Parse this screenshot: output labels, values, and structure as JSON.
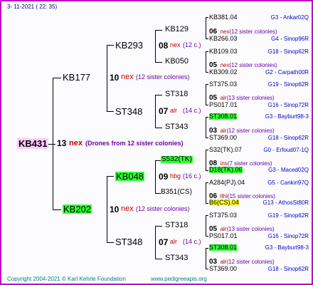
{
  "header": {
    "date": "3- 11-2021 ( 22: 35)"
  },
  "root": {
    "label": "KB431",
    "count": "13",
    "code": "nex",
    "note": "(Drones from 12 sister colonies)"
  },
  "gen1": [
    {
      "label": "KB177",
      "count": "10",
      "code": "nex",
      "note": "(12 sister colonies)"
    },
    {
      "label": "KB202",
      "count": "10",
      "code": "nex",
      "note": "(12 sister colonies)"
    }
  ],
  "gen2": [
    {
      "label": "KB293",
      "count": "08",
      "code": "nex",
      "note": "(12 c.)"
    },
    {
      "label": "ST348",
      "count": "07",
      "code": "alr",
      "note": "(14 c.)"
    },
    {
      "label": "KB048",
      "count": "09",
      "code": "hbg",
      "note": "(16 c.)"
    },
    {
      "label": "ST348",
      "count": "07",
      "code": "alr",
      "note": "(14 c.)"
    }
  ],
  "gen3": [
    {
      "label": "KB129",
      "count": "06",
      "code": "nex",
      "note": "(12 sister colonies)"
    },
    {
      "label": "KB050",
      "count": "05",
      "code": "nex",
      "note": "(12 sister colonies)"
    },
    {
      "label": "ST318",
      "count": "05",
      "code": "alr",
      "note": "(13 sister colonies)"
    },
    {
      "label": "ST343",
      "count": "03",
      "code": "alr",
      "note": "(12 sister colonies)"
    },
    {
      "label": "S532(TK)",
      "count": "08",
      "code": "ins",
      "note": "(7 sister colonies)"
    },
    {
      "label": "B351(CS)",
      "count": "06",
      "code": "lthl",
      "note": "(15 sister colonies)"
    },
    {
      "label": "ST318",
      "count": "05",
      "code": "alr",
      "note": "(13 sister colonies)"
    },
    {
      "label": "ST343",
      "count": "03",
      "code": "alr",
      "note": "(12 sister colonies)"
    }
  ],
  "gen4": [
    {
      "label": "KB381.04",
      "place": "G3 - Ankar02Q"
    },
    {
      "label": "KB266.03",
      "place": "G4 - Sinop96R"
    },
    {
      "label": "KB109.03",
      "place": "G18 - Sinop62R"
    },
    {
      "label": "KB309.02",
      "place": "G2 - Carpath00R"
    },
    {
      "label": "ST375.03",
      "place": "G19 - Sinop62R"
    },
    {
      "label": "PS017.01",
      "place": "G16 - Sinop72R"
    },
    {
      "label": "ST308.01",
      "place": "G3 - Bayburt98-3"
    },
    {
      "label": "ST369.00",
      "place": "G18 - Sinop62R"
    },
    {
      "label": "S32(TK).07",
      "place": "G0 - Erfoud07-1Q"
    },
    {
      "label": "D18(TK).06",
      "place": "G3 - Maced02Q"
    },
    {
      "label": "A284(PJ).04",
      "place": "G5 - Cankiri97Q"
    },
    {
      "label": "B6(CS).04",
      "place": "G13 - AthosSt80R"
    },
    {
      "label": "ST375.03",
      "place": "G19 - Sinop62R"
    },
    {
      "label": "PS017.01",
      "place": "G16 - Sinop72R"
    },
    {
      "label": "ST308.01",
      "place": "G3 - Bayburt98-3"
    },
    {
      "label": "ST369.00",
      "place": "G18 - Sinop62R"
    }
  ],
  "footer": {
    "copyright": "Copyright 2004-2021 © Karl Kehrle Foundation",
    "url": "www.pedigreeapis.org"
  },
  "colors": {
    "border": "#c000c0",
    "highlight": "#33ff33",
    "root_bg": "#ffccff",
    "yellow": "#ffff33",
    "count_red": "#c00000",
    "place_blue": "#0000cc",
    "footer_green": "#008080"
  }
}
